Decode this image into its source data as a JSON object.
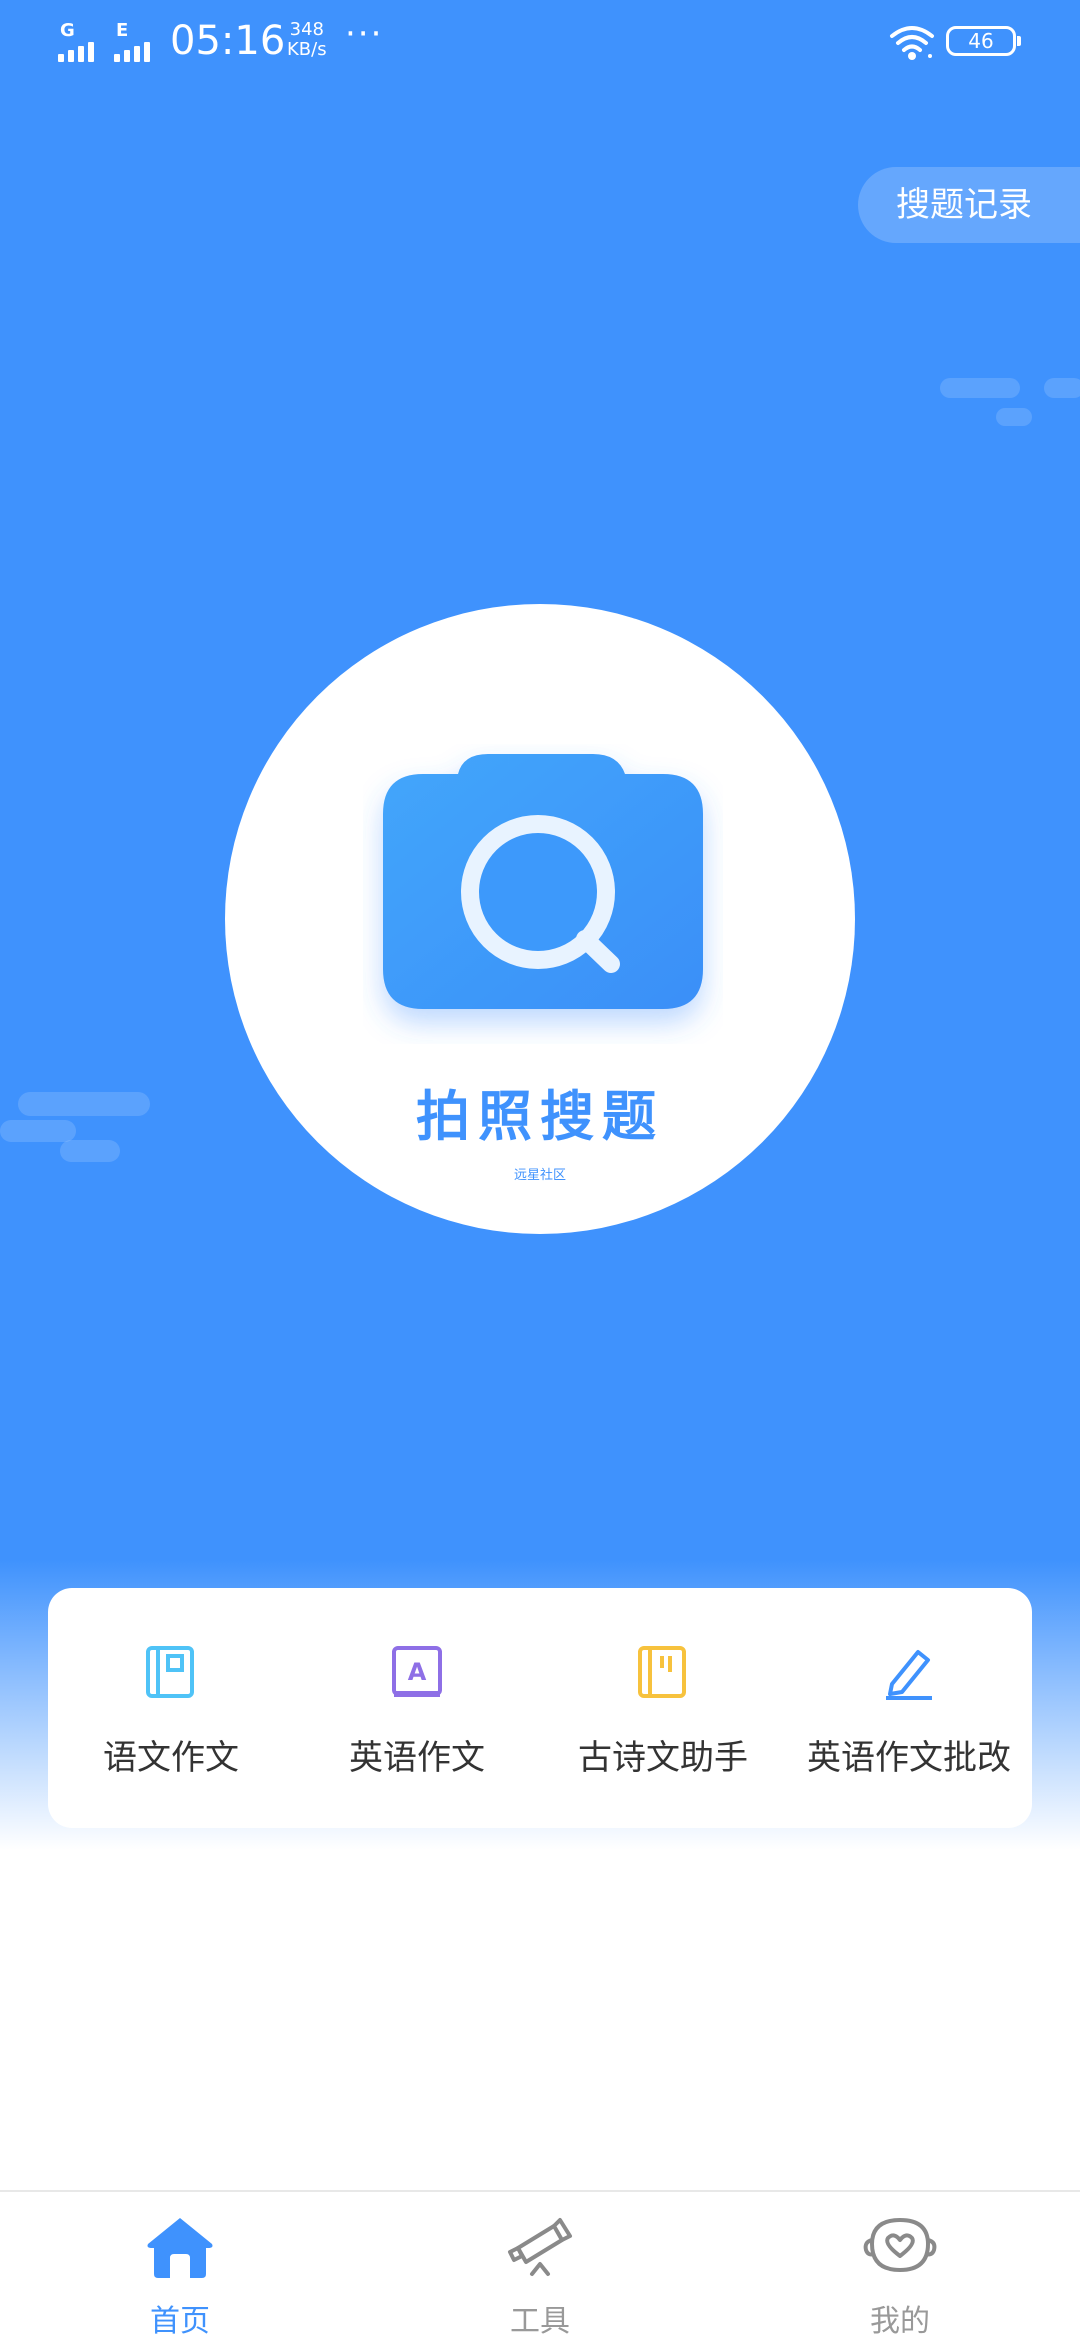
{
  "status_bar": {
    "signal1_label": "G",
    "signal2_label": "E",
    "time": "05:16",
    "speed_value": "348",
    "speed_unit": "KB/s",
    "more": "···",
    "battery": "46"
  },
  "header": {
    "history_button": "搜题记录"
  },
  "camera_search": {
    "title": "拍照搜题",
    "subtitle": "远星社区"
  },
  "tools": [
    {
      "label": "语文作文",
      "icon": "book-icon",
      "color": "#4fc3f7"
    },
    {
      "label": "英语作文",
      "icon": "letter-a-book-icon",
      "color": "#8e6fe6"
    },
    {
      "label": "古诗文助手",
      "icon": "notebook-icon",
      "color": "#f7c23d"
    },
    {
      "label": "英语作文批改",
      "icon": "pencil-edit-icon",
      "color": "#3f92fd"
    }
  ],
  "bottom_nav": [
    {
      "label": "首页",
      "icon": "home-icon",
      "active": true
    },
    {
      "label": "工具",
      "icon": "telescope-icon",
      "active": false
    },
    {
      "label": "我的",
      "icon": "profile-icon",
      "active": false
    }
  ],
  "colors": {
    "accent": "#3f92fd",
    "inactive": "#999999"
  }
}
